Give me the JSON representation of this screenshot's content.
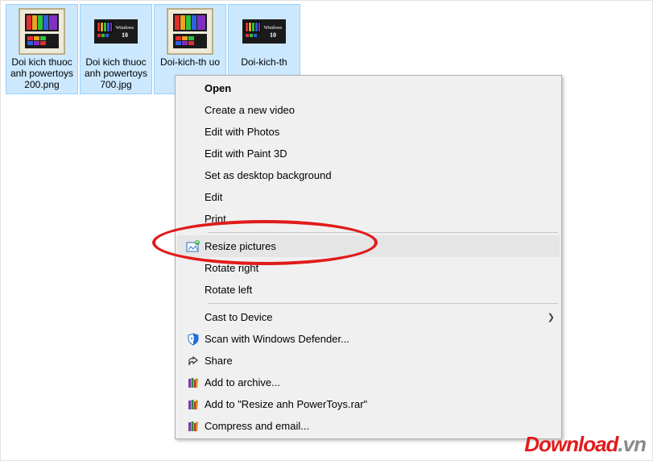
{
  "files": [
    {
      "label": "Doi kich thuoc anh powertoys 200.png",
      "thumb": "large"
    },
    {
      "label": "Doi kich thuoc anh powertoys 700.jpg",
      "thumb": "small"
    },
    {
      "label": "Doi-kich-th uo",
      "thumb": "large",
      "truncated": true
    },
    {
      "label": "Doi-kich-th",
      "thumb": "small",
      "truncated": true
    }
  ],
  "menu": {
    "open": "Open",
    "new_video": "Create a new video",
    "edit_photos": "Edit with Photos",
    "edit_paint3d": "Edit with Paint 3D",
    "set_background": "Set as desktop background",
    "edit": "Edit",
    "print": "Print",
    "resize_pictures": "Resize pictures",
    "rotate_right": "Rotate right",
    "rotate_left": "Rotate left",
    "cast_device": "Cast to Device",
    "scan_defender": "Scan with Windows Defender...",
    "share": "Share",
    "add_archive": "Add to archive...",
    "add_to_named": "Add to \"Resize anh PowerToys.rar\"",
    "compress_email": "Compress and email..."
  },
  "watermark": {
    "part1": "Download",
    "part2": ".vn"
  }
}
